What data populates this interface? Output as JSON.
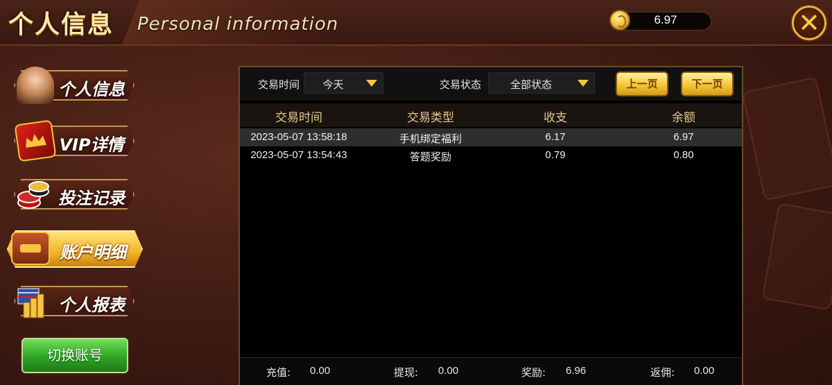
{
  "header": {
    "title_cn": "个人信息",
    "title_en": "Personal information",
    "balance": "6.97",
    "close_symbol": "✕"
  },
  "sidebar": {
    "items": [
      {
        "label": "个人信息",
        "icon": "avatar-girl-icon",
        "active": false
      },
      {
        "label": "VIP详情",
        "icon": "vip-card-icon",
        "active": false
      },
      {
        "label": "投注记录",
        "icon": "chips-icon",
        "active": false
      },
      {
        "label": "账户明细",
        "icon": "wallet-icon",
        "active": true
      },
      {
        "label": "个人报表",
        "icon": "report-chart-icon",
        "active": false
      }
    ],
    "switch_account": "切换账号"
  },
  "filters": {
    "time_label": "交易时间",
    "time_value": "今天",
    "status_label": "交易状态",
    "status_value": "全部状态",
    "prev_page": "上一页",
    "next_page": "下一页"
  },
  "table": {
    "columns": [
      "交易时间",
      "交易类型",
      "收支",
      "余额"
    ],
    "rows": [
      [
        "2023-05-07 13:58:18",
        "手机绑定福利",
        "6.17",
        "6.97"
      ],
      [
        "2023-05-07 13:54:43",
        "答题奖励",
        "0.79",
        "0.80"
      ]
    ]
  },
  "summary": {
    "recharge_label": "充值:",
    "recharge_value": "0.00",
    "withdraw_label": "提现:",
    "withdraw_value": "0.00",
    "reward_label": "奖励:",
    "reward_value": "6.96",
    "rebate_label": "返佣:",
    "rebate_value": "0.00"
  },
  "colors": {
    "accent_gold": "#f5c542",
    "header_text": "#e6c98f",
    "active_tab": "#f3b52a",
    "switch_green": "#2fa524"
  }
}
